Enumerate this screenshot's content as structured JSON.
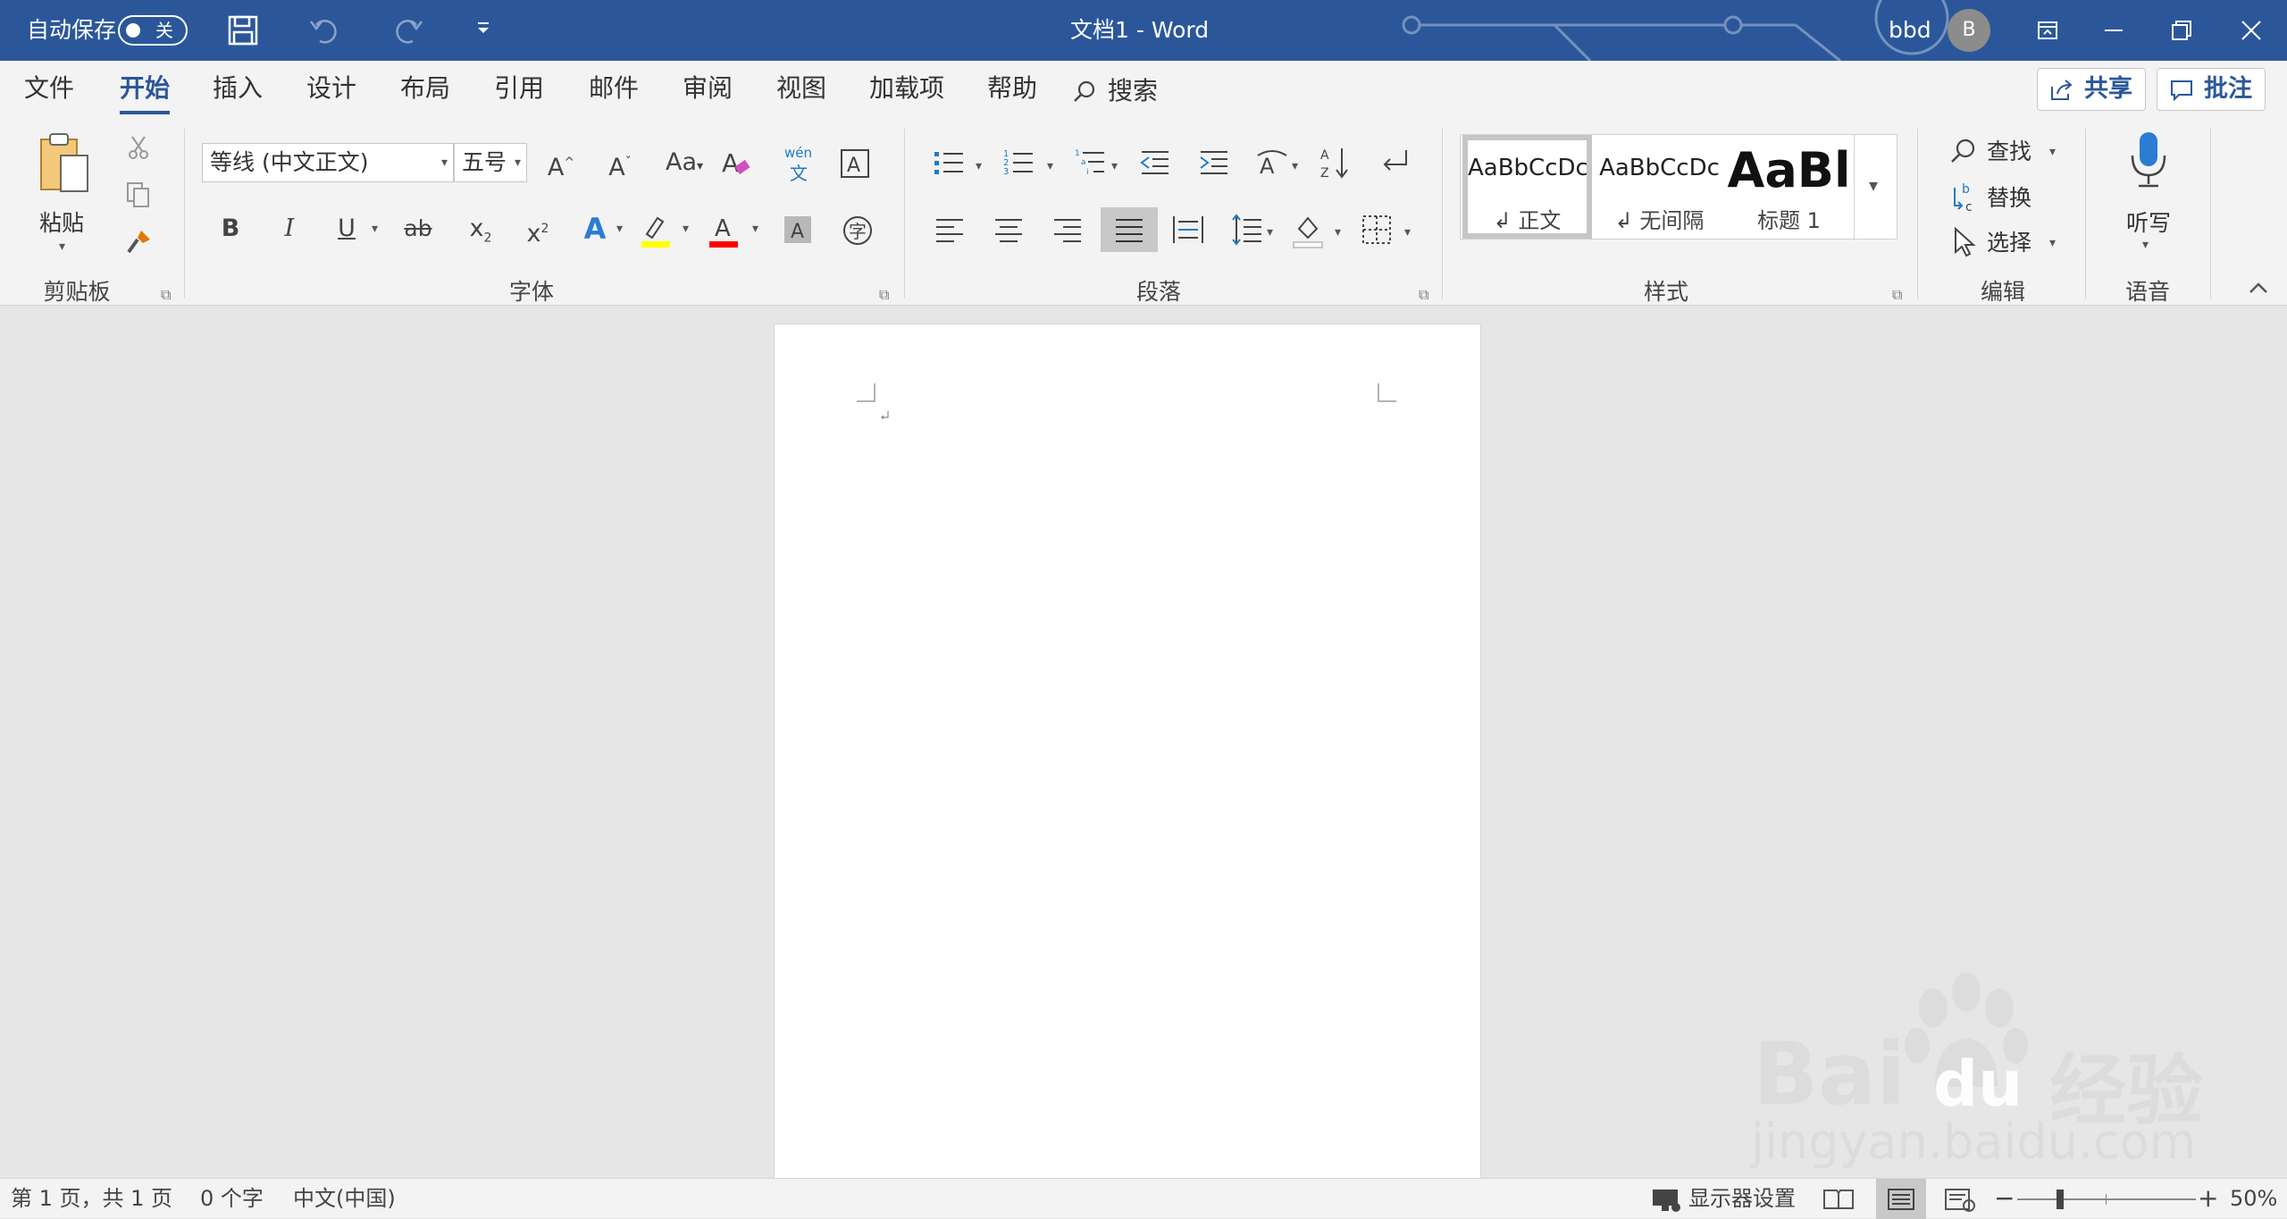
{
  "titlebar": {
    "autosave_label": "自动保存",
    "autosave_state": "关",
    "document_title": "文档1  -  Word",
    "user_name": "bbd",
    "avatar_initial": "B"
  },
  "tabs": [
    "文件",
    "开始",
    "插入",
    "设计",
    "布局",
    "引用",
    "邮件",
    "审阅",
    "视图",
    "加载项",
    "帮助"
  ],
  "search_label": "搜索",
  "share_label": "共享",
  "comment_label": "批注",
  "clipboard": {
    "paste_label": "粘贴",
    "group_label": "剪贴板"
  },
  "font": {
    "name": "等线 (中文正文)",
    "size": "五号",
    "group_label": "字体",
    "phonetic_top": "wén",
    "phonetic_bottom": "文"
  },
  "paragraph": {
    "group_label": "段落"
  },
  "styles": {
    "group_label": "样式",
    "items": [
      {
        "sample": "AaBbCcDc",
        "name": "↲ 正文"
      },
      {
        "sample": "AaBbCcDc",
        "name": "↲ 无间隔"
      },
      {
        "sample": "AaBl",
        "name": "标题 1"
      }
    ]
  },
  "editing": {
    "find": "查找",
    "replace": "替换",
    "select": "选择",
    "group_label": "编辑"
  },
  "voice": {
    "dictate": "听写",
    "group_label": "语音"
  },
  "status": {
    "page": "第 1 页，共 1 页",
    "words": "0 个字",
    "language": "中文(中国)",
    "display_settings": "显示器设置",
    "zoom": "50%"
  },
  "watermark": {
    "brand": "Bai",
    "brand2": "du",
    "cn": "经验",
    "url": "jingyan.baidu.com"
  },
  "colors": {
    "accent": "#2b579a",
    "highlight": "#ffff00",
    "font_color": "#ff0000"
  }
}
